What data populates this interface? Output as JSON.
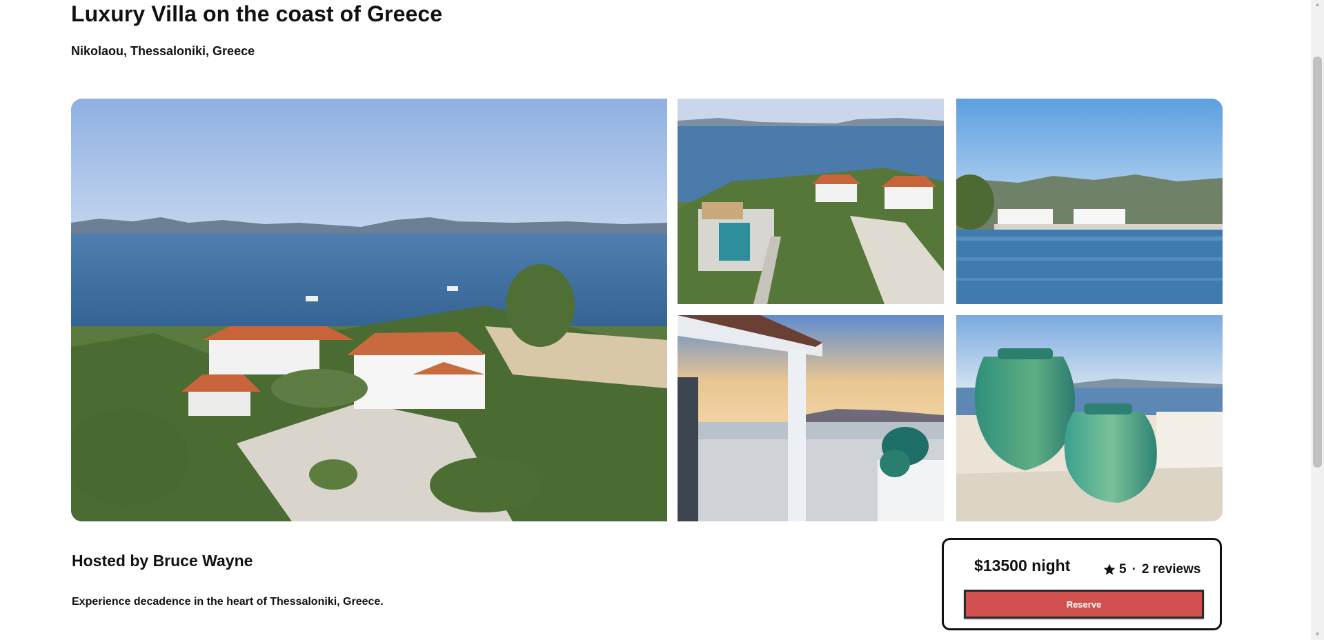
{
  "listing": {
    "title": "Luxury Villa on the coast of Greece",
    "location": "Nikolaou, Thessaloniki, Greece",
    "host": "Hosted by Bruce Wayne",
    "description": "Experience decadence in the heart of Thessaloniki, Greece."
  },
  "gallery": {
    "photos": [
      "aerial view of villa with orange tile roofs, olive trees and sea",
      "aerial view of villa with swimming pool and olive grove by the sea",
      "white villa on the waterfront with green hills behind",
      "covered terrace with sunset over the sea",
      "two large green ceramic urns on a terrace overlooking the sea"
    ]
  },
  "booking": {
    "price": "$13500 night",
    "rating": "5",
    "separator": "·",
    "reviews": "2 reviews",
    "reserve_label": "Reserve",
    "reserve_color": "#d15050"
  },
  "icons": {
    "rating": "star-icon",
    "scroll_up": "up-arrow-icon",
    "scroll_down": "down-arrow-icon"
  }
}
